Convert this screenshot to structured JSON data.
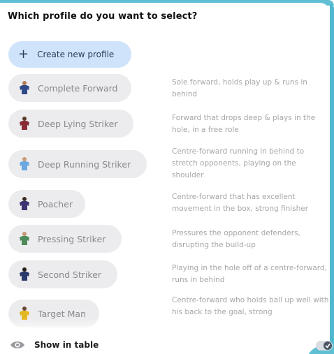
{
  "dialog": {
    "title": "Which profile do you want to select?",
    "create_label": "Create new profile",
    "create_icon": "plus-icon"
  },
  "profiles": [
    {
      "name": "Complete Forward",
      "description": "Sole forward, holds play up & runs in behind",
      "kit": "#2f4a88"
    },
    {
      "name": "Deep Lying Striker",
      "description": "Forward that drops deep & plays in the hole, in a free role",
      "kit": "#8a2c35"
    },
    {
      "name": "Deep Running Striker",
      "description": "Centre-forward running in behind to stretch opponents, playing on the shoulder",
      "kit": "#6aa9df"
    },
    {
      "name": "Poacher",
      "description": "Centre-forward that has excellent movement in the box, strong finisher",
      "kit": "#3d3572"
    },
    {
      "name": "Pressing Striker",
      "description": "Pressures the opponent defenders, disrupting the build-up",
      "kit": "#4d8b5a"
    },
    {
      "name": "Second Striker",
      "description": "Playing in the hole off of a centre-forward, runs in behind",
      "kit": "#2a3a6b"
    },
    {
      "name": "Target Man",
      "description": "Centre-forward who holds ball up well with his back to the goal, strong",
      "kit": "#e3b722"
    }
  ],
  "footer": {
    "show_table_label": "Show in table",
    "show_table_icon": "eye-icon"
  },
  "colors": {
    "accent": "#5fc0d4",
    "create_button_bg": "#cfe3fa",
    "pill_bg": "#ececee",
    "pill_text": "#8a8a8e",
    "description_text": "#a7a7aa"
  }
}
